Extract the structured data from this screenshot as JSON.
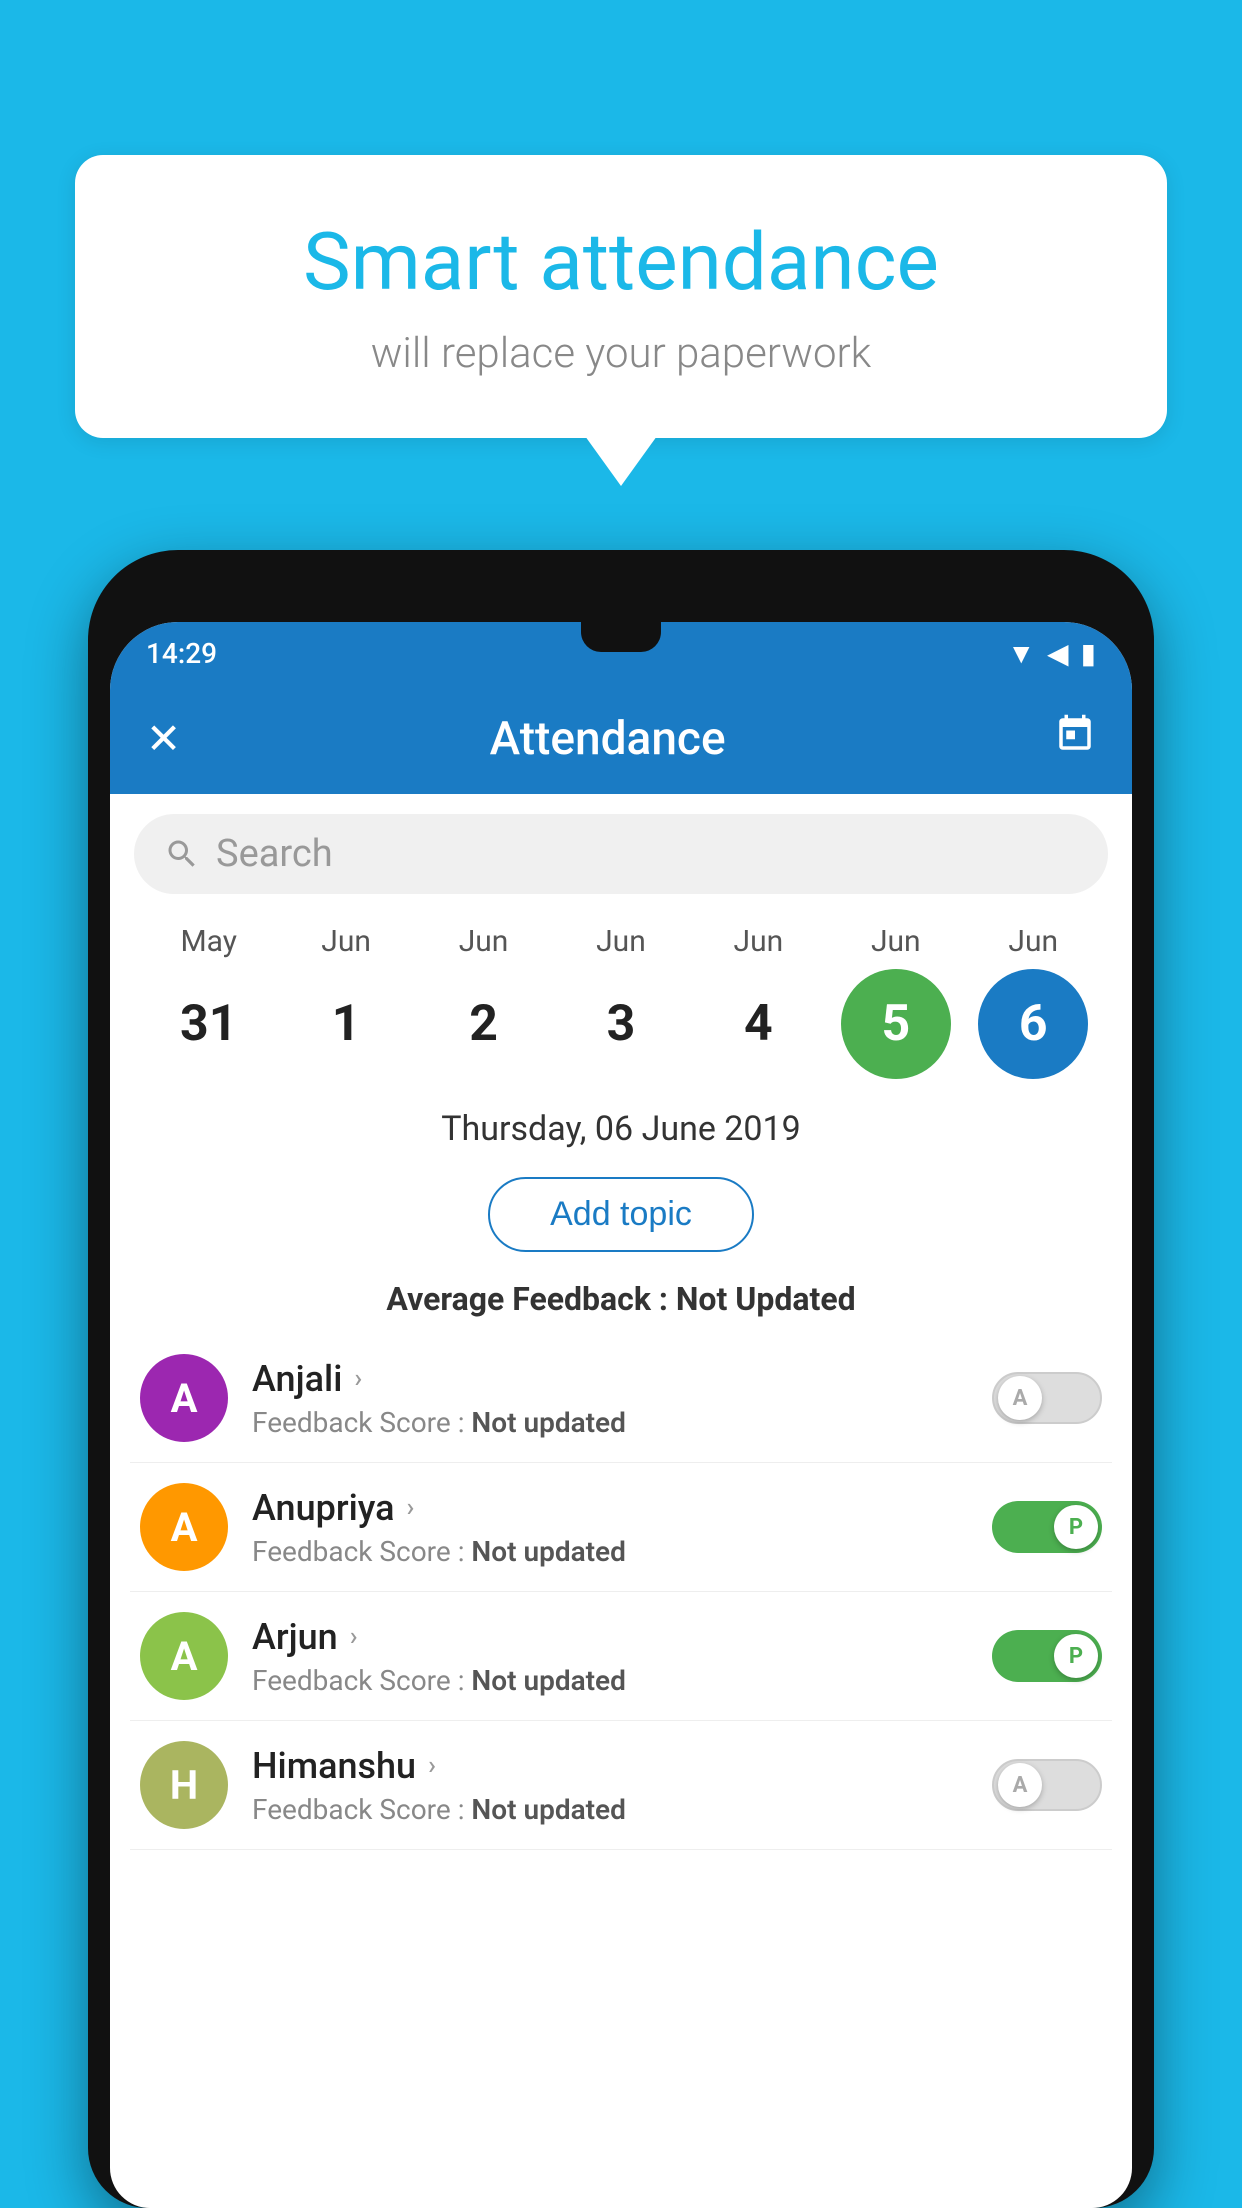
{
  "background_color": "#1bb8e8",
  "speech_bubble": {
    "title": "Smart attendance",
    "subtitle": "will replace your paperwork"
  },
  "status_bar": {
    "time": "14:29",
    "icons": [
      "wifi",
      "signal",
      "battery"
    ]
  },
  "app_bar": {
    "close_label": "✕",
    "title": "Attendance",
    "calendar_icon": "📅"
  },
  "search": {
    "placeholder": "Search"
  },
  "calendar": {
    "months": [
      "May",
      "Jun",
      "Jun",
      "Jun",
      "Jun",
      "Jun",
      "Jun"
    ],
    "dates": [
      "31",
      "1",
      "2",
      "3",
      "4",
      "5",
      "6"
    ],
    "selected_date": "6",
    "today_date": "5",
    "display_date": "Thursday, 06 June 2019"
  },
  "add_topic": {
    "label": "Add topic"
  },
  "avg_feedback": {
    "label": "Average Feedback : ",
    "value": "Not Updated"
  },
  "students": [
    {
      "name": "Anjali",
      "avatar_letter": "A",
      "avatar_color": "#9c27b0",
      "feedback": "Not updated",
      "toggle_state": "off",
      "toggle_letter": "A"
    },
    {
      "name": "Anupriya",
      "avatar_letter": "A",
      "avatar_color": "#ff9800",
      "feedback": "Not updated",
      "toggle_state": "on",
      "toggle_letter": "P"
    },
    {
      "name": "Arjun",
      "avatar_letter": "A",
      "avatar_color": "#8bc34a",
      "feedback": "Not updated",
      "toggle_state": "on",
      "toggle_letter": "P"
    },
    {
      "name": "Himanshu",
      "avatar_letter": "H",
      "avatar_color": "#aab560",
      "feedback": "Not updated",
      "toggle_state": "off",
      "toggle_letter": "A"
    }
  ],
  "feedback_label": "Feedback Score : "
}
